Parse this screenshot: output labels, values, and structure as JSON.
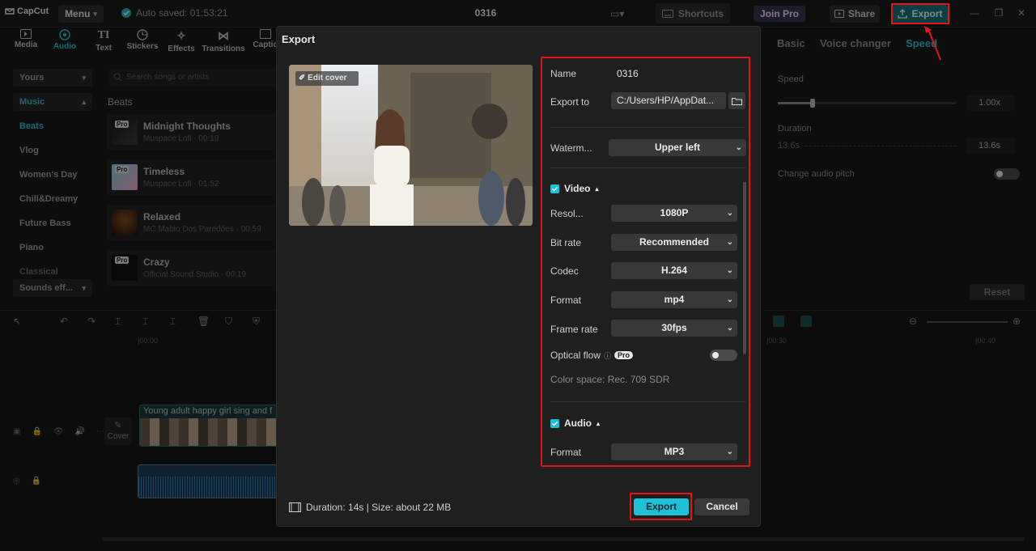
{
  "app": {
    "logo_text": "CapCut",
    "menu_label": "Menu",
    "autosave": "Auto saved: 01:53:21",
    "project_title": "0316",
    "shortcuts_label": "Shortcuts",
    "join_pro_label": "Join Pro",
    "share_label": "Share",
    "export_label": "Export"
  },
  "left_tools": [
    "Media",
    "Audio",
    "Text",
    "Stickers",
    "Effects",
    "Transitions",
    "Captio"
  ],
  "left_categories": {
    "yours": "Yours",
    "music": "Music",
    "items": [
      "Beats",
      "Vlog",
      "Women's Day",
      "Chill&Dreamy",
      "Future Bass",
      "Piano",
      "Classical"
    ],
    "sound_effects": "Sounds eff..."
  },
  "search_placeholder": "Search songs or artists",
  "beats_heading": "Beats",
  "tracks": [
    {
      "title": "Midnight Thoughts",
      "sub": "Muspace Lofi · 00:19",
      "badge": "Pro"
    },
    {
      "title": "Timeless",
      "sub": "Muspace Lofi · 01:52",
      "badge": "Pro"
    },
    {
      "title": "Relaxed",
      "sub": "MC Mablo Dos Paredões · 00:59",
      "badge": ""
    },
    {
      "title": "Crazy",
      "sub": "Official Sound Studio · 00:19",
      "badge": "Pro"
    }
  ],
  "right_panel": {
    "tabs": [
      "Basic",
      "Voice changer",
      "Speed"
    ],
    "speed_label": "Speed",
    "speed_value": "1.00x",
    "duration_label": "Duration",
    "duration_left": "13.6s",
    "duration_value": "13.6s",
    "pitch_label": "Change audio pitch",
    "reset_label": "Reset"
  },
  "timeline": {
    "ruler_start": "|00:00",
    "ruler_mid": "|00:30",
    "ruler_end": "|00:40",
    "cover_label": "Cover",
    "clip_label": "Young adult happy girl sing and f"
  },
  "modal": {
    "title": "Export",
    "edit_cover": "Edit cover",
    "name_label": "Name",
    "name_value": "0316",
    "export_to_label": "Export to",
    "export_to_value": "C:/Users/HP/AppDat...",
    "watermark_label": "Waterm...",
    "watermark_value": "Upper left",
    "video_section": "Video",
    "resolution_label": "Resol...",
    "resolution_value": "1080P",
    "bitrate_label": "Bit rate",
    "bitrate_value": "Recommended",
    "codec_label": "Codec",
    "codec_value": "H.264",
    "format_label": "Format",
    "format_value": "mp4",
    "framerate_label": "Frame rate",
    "framerate_value": "30fps",
    "optical_flow_label": "Optical flow",
    "optical_flow_badge": "Pro",
    "color_space": "Color space: Rec. 709 SDR",
    "audio_section": "Audio",
    "audio_format_label": "Format",
    "audio_format_value": "MP3",
    "footer_info": "Duration: 14s | Size: about 22 MB",
    "export_button": "Export",
    "cancel_button": "Cancel"
  },
  "colors": {
    "accent": "#1ec0d6",
    "highlight": "#e0141b"
  }
}
